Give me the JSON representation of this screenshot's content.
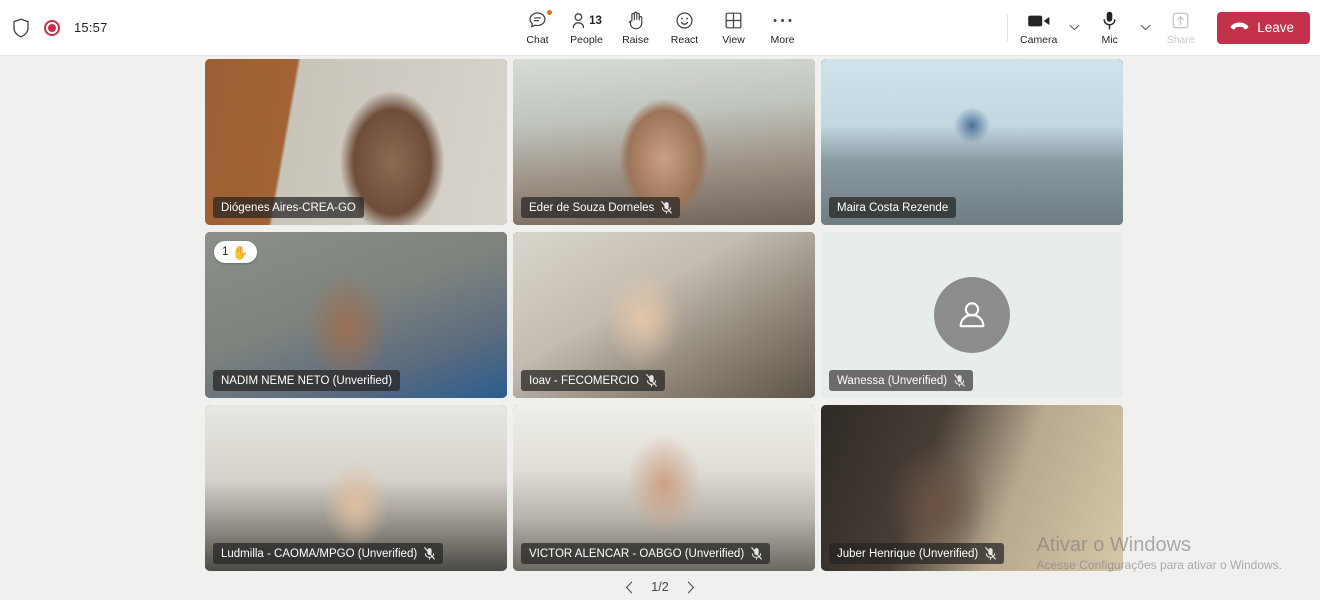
{
  "toolbar": {
    "shield_icon": "shield-icon",
    "recording_icon": "recording-indicator-icon",
    "clock": "15:57",
    "buttons": [
      {
        "id": "chat",
        "label": "Chat",
        "icon": "chat-icon",
        "badge": true
      },
      {
        "id": "people",
        "label": "People",
        "icon": "people-icon",
        "count": "13"
      },
      {
        "id": "raise",
        "label": "Raise",
        "icon": "raise-hand-icon"
      },
      {
        "id": "react",
        "label": "React",
        "icon": "emoji-react-icon"
      },
      {
        "id": "view",
        "label": "View",
        "icon": "grid-view-icon"
      },
      {
        "id": "more",
        "label": "More",
        "icon": "more-ellipsis-icon"
      }
    ],
    "camera": {
      "label": "Camera",
      "icon": "camera-icon",
      "disabled": false
    },
    "mic": {
      "label": "Mic",
      "icon": "microphone-icon",
      "disabled": false
    },
    "share": {
      "label": "Share",
      "icon": "share-screen-icon",
      "disabled": true
    },
    "leave": {
      "label": "Leave",
      "icon": "hangup-phone-icon",
      "color": "#C4314B"
    }
  },
  "stage": {
    "active_speaker_color": "#6264A7",
    "raised_hand_color": "#D9A514",
    "participants": [
      {
        "name": "Diógenes Aires-CREA-GO",
        "muted": false,
        "video": true,
        "state": "normal"
      },
      {
        "name": "Eder de Souza Dorneles",
        "muted": true,
        "video": true,
        "state": "normal"
      },
      {
        "name": "Maira Costa Rezende",
        "muted": false,
        "video": true,
        "state": "active-speaker"
      },
      {
        "name": "NADIM NEME NETO (Unverified)",
        "muted": false,
        "video": true,
        "state": "raised-hand",
        "hand_count": "1",
        "hand_emoji": "✋"
      },
      {
        "name": "Ioav - FECOMERCIO",
        "muted": true,
        "video": true,
        "state": "normal"
      },
      {
        "name": "Wanessa (Unverified)",
        "muted": true,
        "video": false,
        "state": "normal",
        "avatar_icon": "person-avatar-icon"
      },
      {
        "name": "Ludmilla - CAOMA/MPGO (Unverified)",
        "muted": true,
        "video": true,
        "state": "normal"
      },
      {
        "name": "VICTOR ALENCAR - OABGO (Unverified)",
        "muted": true,
        "video": true,
        "state": "normal"
      },
      {
        "name": "Juber Henrique (Unverified)",
        "muted": true,
        "video": true,
        "state": "normal"
      }
    ]
  },
  "pagination": {
    "prev_icon": "chevron-left-icon",
    "next_icon": "chevron-right-icon",
    "page_label": "1/2"
  },
  "watermark": {
    "title": "Ativar o Windows",
    "subtitle": "Acesse Configurações para ativar o Windows."
  }
}
